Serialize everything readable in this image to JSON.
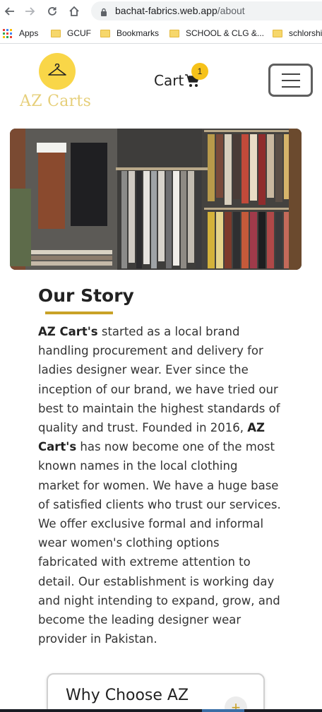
{
  "browser": {
    "url_host": "bachat-fabrics.web.app",
    "url_path": "/about",
    "bookmarks": [
      {
        "label": "Apps",
        "type": "apps"
      },
      {
        "label": "GCUF",
        "type": "folder"
      },
      {
        "label": "Bookmarks",
        "type": "folder"
      },
      {
        "label": "SCHOOL & CLG &...",
        "type": "folder"
      },
      {
        "label": "schlorship",
        "type": "folder"
      }
    ]
  },
  "header": {
    "brand": "AZ Carts",
    "cart_label": "Cart",
    "cart_count": "1"
  },
  "story": {
    "title": "Our Story",
    "brand_bold": "AZ Cart's",
    "text_1": " started as a local brand handling procurement and delivery for ladies designer wear. Ever since the inception of our brand, we have tried our best to maintain the highest standards of quality and trust. Founded in 2016, ",
    "brand_bold_2": "AZ Cart's",
    "text_2": " has now become one of the most known names in the local clothing market for women. We have a huge base of satisfied clients who trust our services. We offer exclusive formal and informal wear women's clothing options fabricated with extreme attention to detail. Our establishment is working day and night intending to expand, grow, and become the leading designer wear provider in Pakistan."
  },
  "why": {
    "title": "Why Choose AZ",
    "toggle": "+"
  },
  "colors": {
    "accent_yellow": "#f9d648",
    "underline_gold": "#c9a227",
    "brand_text": "#e6cf7a"
  }
}
